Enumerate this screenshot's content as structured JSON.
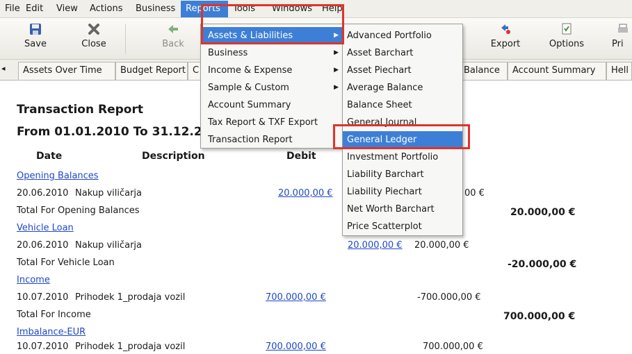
{
  "menubar": {
    "items": [
      "File",
      "Edit",
      "View",
      "Actions",
      "Business",
      "Reports",
      "Tools",
      "Windows",
      "Help"
    ]
  },
  "toolbar": {
    "save": "Save",
    "close": "Close",
    "back": "Back",
    "export_partial": "t",
    "export": "Export",
    "options": "Options",
    "print_partial": "Pri"
  },
  "tabs": {
    "assets_over_time": "Assets Over Time",
    "budget_report": "Budget Report",
    "c_partial": "C",
    "balance": "Balance",
    "account_summary": "Account Summary",
    "hello_partial": "Hell"
  },
  "report": {
    "title": "Transaction Report",
    "range": "From 01.01.2010 To 31.12.20",
    "headers": {
      "date": "Date",
      "description": "Description",
      "debit": "Debit"
    },
    "rows": [
      {
        "type": "group",
        "label": "Opening Balances"
      },
      {
        "type": "line",
        "date": "20.06.2010",
        "desc": "Nakup viličarja",
        "debit": "20.000,00 €",
        "col4": "00 €"
      },
      {
        "type": "total",
        "label": "Total For Opening Balances",
        "total": "20.000,00 €"
      },
      {
        "type": "group",
        "label": "Vehicle Loan"
      },
      {
        "type": "line",
        "date": "20.06.2010",
        "desc": "Nakup viličarja",
        "credit": "20.000,00 €",
        "col4": "20.000,00 €"
      },
      {
        "type": "total",
        "label": "Total For Vehicle Loan",
        "total": "-20.000,00 €"
      },
      {
        "type": "group",
        "label": "Income"
      },
      {
        "type": "line",
        "date": "10.07.2010",
        "desc": "Prihodek 1_prodaja vozil",
        "debit": "700.000,00 €",
        "col4": "-700.000,00 €"
      },
      {
        "type": "total",
        "label": "Total For Income",
        "total": "700.000,00 €"
      },
      {
        "type": "group",
        "label": "Imbalance-EUR"
      },
      {
        "type": "line",
        "date": "10.07.2010",
        "desc": "Prihodek 1_prodaja vozil",
        "debit": "700.000,00 €",
        "col4": "700.000,00 €"
      }
    ]
  },
  "reports_menu": {
    "items": [
      "Assets & Liabilities",
      "Business",
      "Income & Expense",
      "Sample & Custom",
      "Account Summary",
      "Tax Report & TXF Export",
      "Transaction Report"
    ]
  },
  "assets_submenu": {
    "items": [
      "Advanced Portfolio",
      "Asset Barchart",
      "Asset Piechart",
      "Average Balance",
      "Balance Sheet",
      "General Journal",
      "General Ledger",
      "Investment Portfolio",
      "Liability Barchart",
      "Liability Piechart",
      "Net Worth Barchart",
      "Price Scatterplot"
    ]
  },
  "icons": {
    "save": "floppy-disk-icon",
    "close": "close-x-icon",
    "back": "back-arrow-icon",
    "export": "export-icon",
    "options": "options-icon",
    "print": "printer-icon",
    "submenu_arrow": "chevron-right-icon"
  },
  "colors": {
    "highlight": "#3d7fd6",
    "callout": "#e0332a",
    "link": "#1f47c6"
  }
}
